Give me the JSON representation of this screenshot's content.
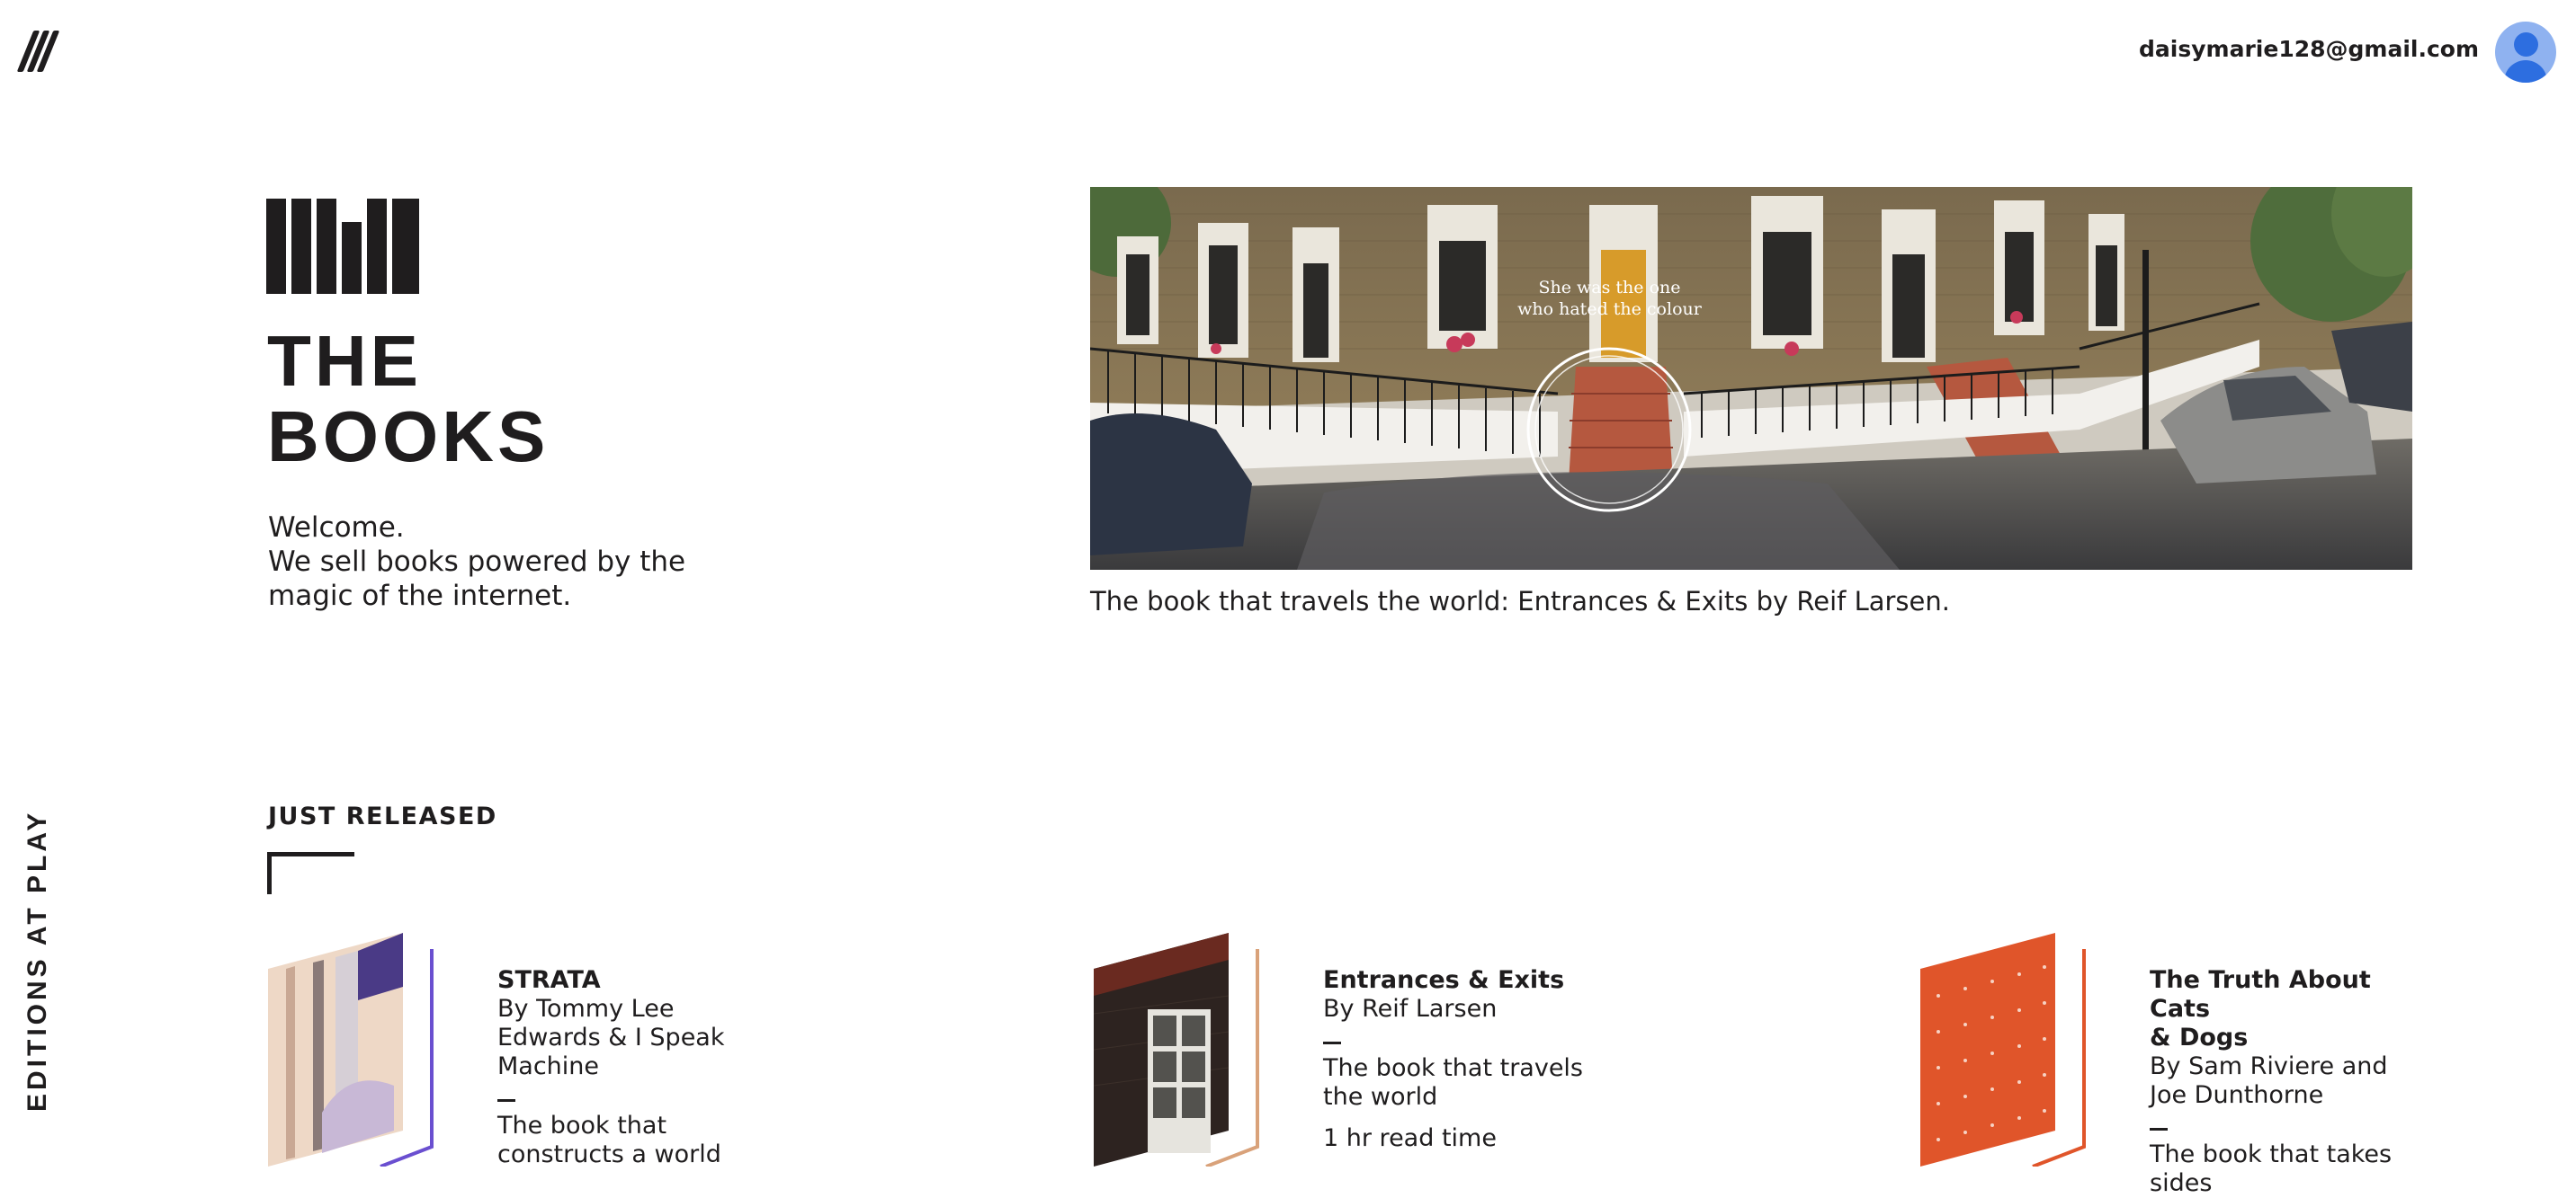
{
  "header": {
    "user_email": "daisymarie128@gmail.com"
  },
  "side_label": "EDITIONS AT PLAY",
  "intro": {
    "title_line1": "THE",
    "title_line2": "BOOKS",
    "welcome": "Welcome.",
    "tagline_line1": "We sell books powered by the",
    "tagline_line2": "magic of the internet."
  },
  "hero": {
    "overlay_line1": "She was the one",
    "overlay_line2": "who hated the colour",
    "caption": "The book that travels the world: Entrances & Exits by Reif Larsen."
  },
  "just_released": {
    "heading": "JUST RELEASED",
    "books": [
      {
        "title": "STRATA",
        "author_lines": [
          "By Tommy Lee",
          "Edwards & I Speak",
          "Machine"
        ],
        "blurb_lines": [
          "The book that",
          "constructs a world"
        ],
        "read_time": "",
        "accent": "#6a4fd0"
      },
      {
        "title": "Entrances & Exits",
        "author_lines": [
          "By Reif Larsen"
        ],
        "blurb_lines": [
          "The book that travels",
          "the world"
        ],
        "read_time": "1 hr read time",
        "accent": "#d9a27a"
      },
      {
        "title_lines": [
          "The Truth About Cats",
          "& Dogs"
        ],
        "author_lines": [
          "By Sam Riviere and",
          "Joe Dunthorne"
        ],
        "blurb_lines": [
          "The book that takes",
          "sides"
        ],
        "read_time": "",
        "accent": "#e0552a"
      }
    ]
  }
}
